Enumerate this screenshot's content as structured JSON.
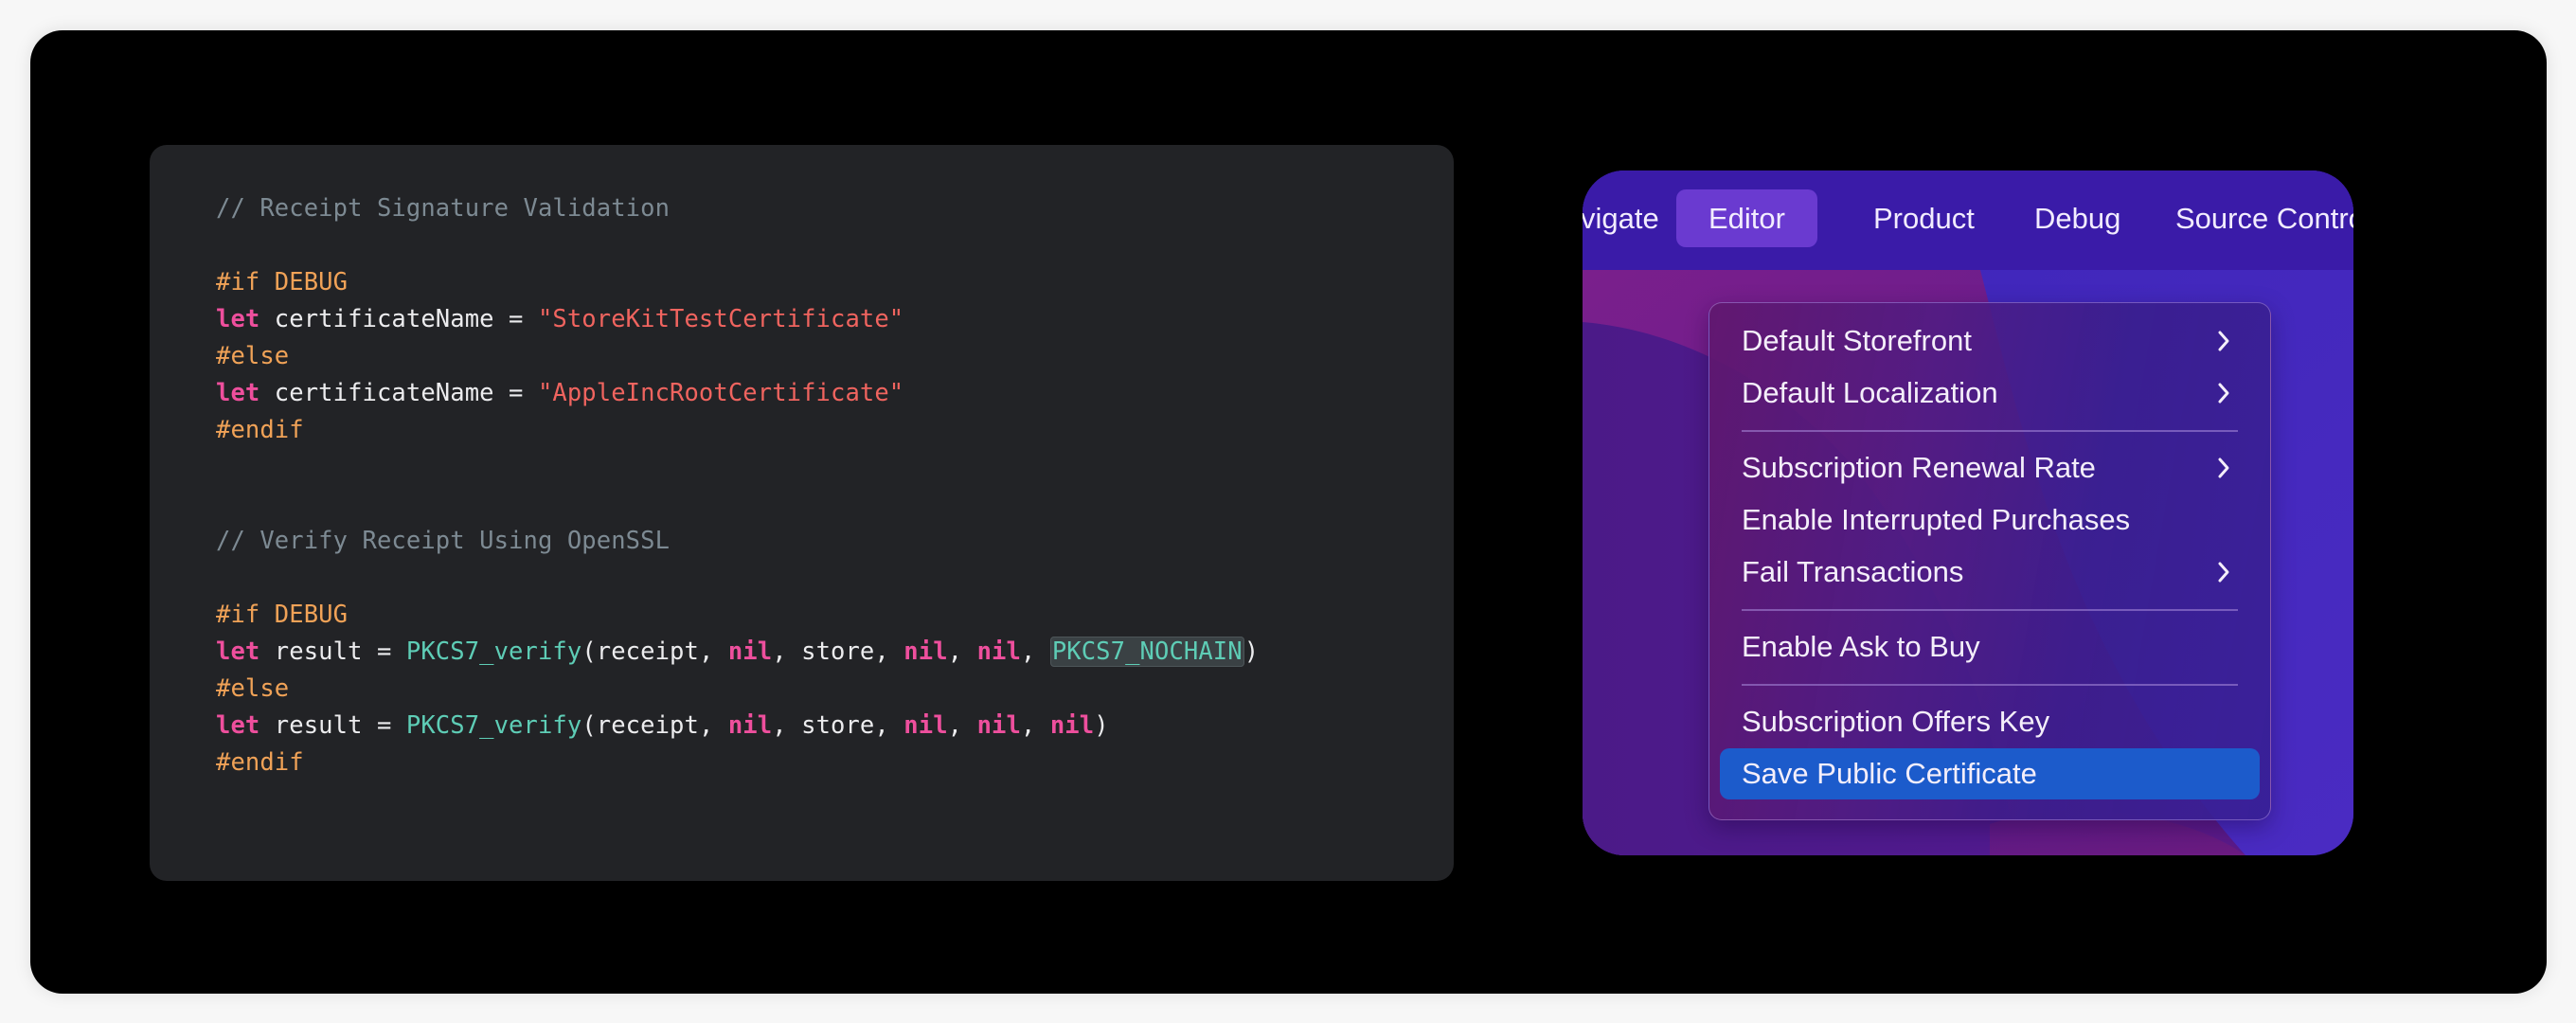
{
  "code_panel": {
    "lines": [
      [
        {
          "t": "comment",
          "s": "// Receipt Signature Validation"
        }
      ],
      [],
      [
        {
          "t": "pre",
          "s": "#if DEBUG"
        }
      ],
      [
        {
          "t": "kw",
          "s": "let"
        },
        {
          "t": "plain",
          "s": " certificateName = "
        },
        {
          "t": "str",
          "s": "\"StoreKitTestCertificate\""
        }
      ],
      [
        {
          "t": "pre",
          "s": "#else"
        }
      ],
      [
        {
          "t": "kw",
          "s": "let"
        },
        {
          "t": "plain",
          "s": " certificateName = "
        },
        {
          "t": "str",
          "s": "\"AppleIncRootCertificate\""
        }
      ],
      [
        {
          "t": "pre",
          "s": "#endif"
        }
      ],
      [],
      [],
      [
        {
          "t": "comment",
          "s": "// Verify Receipt Using OpenSSL"
        }
      ],
      [],
      [
        {
          "t": "pre",
          "s": "#if DEBUG"
        }
      ],
      [
        {
          "t": "kw",
          "s": "let"
        },
        {
          "t": "plain",
          "s": " result = "
        },
        {
          "t": "fn",
          "s": "PKCS7_verify"
        },
        {
          "t": "plain",
          "s": "(receipt, "
        },
        {
          "t": "kw",
          "s": "nil"
        },
        {
          "t": "plain",
          "s": ", store, "
        },
        {
          "t": "kw",
          "s": "nil"
        },
        {
          "t": "plain",
          "s": ", "
        },
        {
          "t": "kw",
          "s": "nil"
        },
        {
          "t": "plain",
          "s": ", "
        },
        {
          "t": "hl",
          "s": "PKCS7_NOCHAIN"
        },
        {
          "t": "plain",
          "s": ")"
        }
      ],
      [
        {
          "t": "pre",
          "s": "#else"
        }
      ],
      [
        {
          "t": "kw",
          "s": "let"
        },
        {
          "t": "plain",
          "s": " result = "
        },
        {
          "t": "fn",
          "s": "PKCS7_verify"
        },
        {
          "t": "plain",
          "s": "(receipt, "
        },
        {
          "t": "kw",
          "s": "nil"
        },
        {
          "t": "plain",
          "s": ", store, "
        },
        {
          "t": "kw",
          "s": "nil"
        },
        {
          "t": "plain",
          "s": ", "
        },
        {
          "t": "kw",
          "s": "nil"
        },
        {
          "t": "plain",
          "s": ", "
        },
        {
          "t": "kw",
          "s": "nil"
        },
        {
          "t": "plain",
          "s": ")"
        }
      ],
      [
        {
          "t": "pre",
          "s": "#endif"
        }
      ]
    ]
  },
  "menubar": {
    "items": [
      {
        "label": "vigate",
        "active": false
      },
      {
        "label": "Editor",
        "active": true
      },
      {
        "label": "Product",
        "active": false
      },
      {
        "label": "Debug",
        "active": false
      },
      {
        "label": "Source Contro",
        "active": false
      }
    ]
  },
  "editor_menu": {
    "items": [
      {
        "label": "Default Storefront",
        "submenu": true,
        "highlighted": false
      },
      {
        "label": "Default Localization",
        "submenu": true,
        "highlighted": false
      },
      {
        "separator": true
      },
      {
        "label": "Subscription Renewal Rate",
        "submenu": true,
        "highlighted": false
      },
      {
        "label": "Enable Interrupted Purchases",
        "submenu": false,
        "highlighted": false
      },
      {
        "label": "Fail Transactions",
        "submenu": true,
        "highlighted": false
      },
      {
        "separator": true
      },
      {
        "label": "Enable Ask to Buy",
        "submenu": false,
        "highlighted": false
      },
      {
        "separator": true
      },
      {
        "label": "Subscription Offers Key",
        "submenu": false,
        "highlighted": false
      },
      {
        "label": "Save Public Certificate",
        "submenu": false,
        "highlighted": true
      }
    ]
  },
  "colors": {
    "comment": "#7d8a93",
    "preprocessor": "#f0a257",
    "keyword": "#ee4f9d",
    "string": "#f0645f",
    "function": "#5ecdb6",
    "menu_highlight": "#1c5bcb",
    "menubar_active": "#6a3ad0"
  }
}
